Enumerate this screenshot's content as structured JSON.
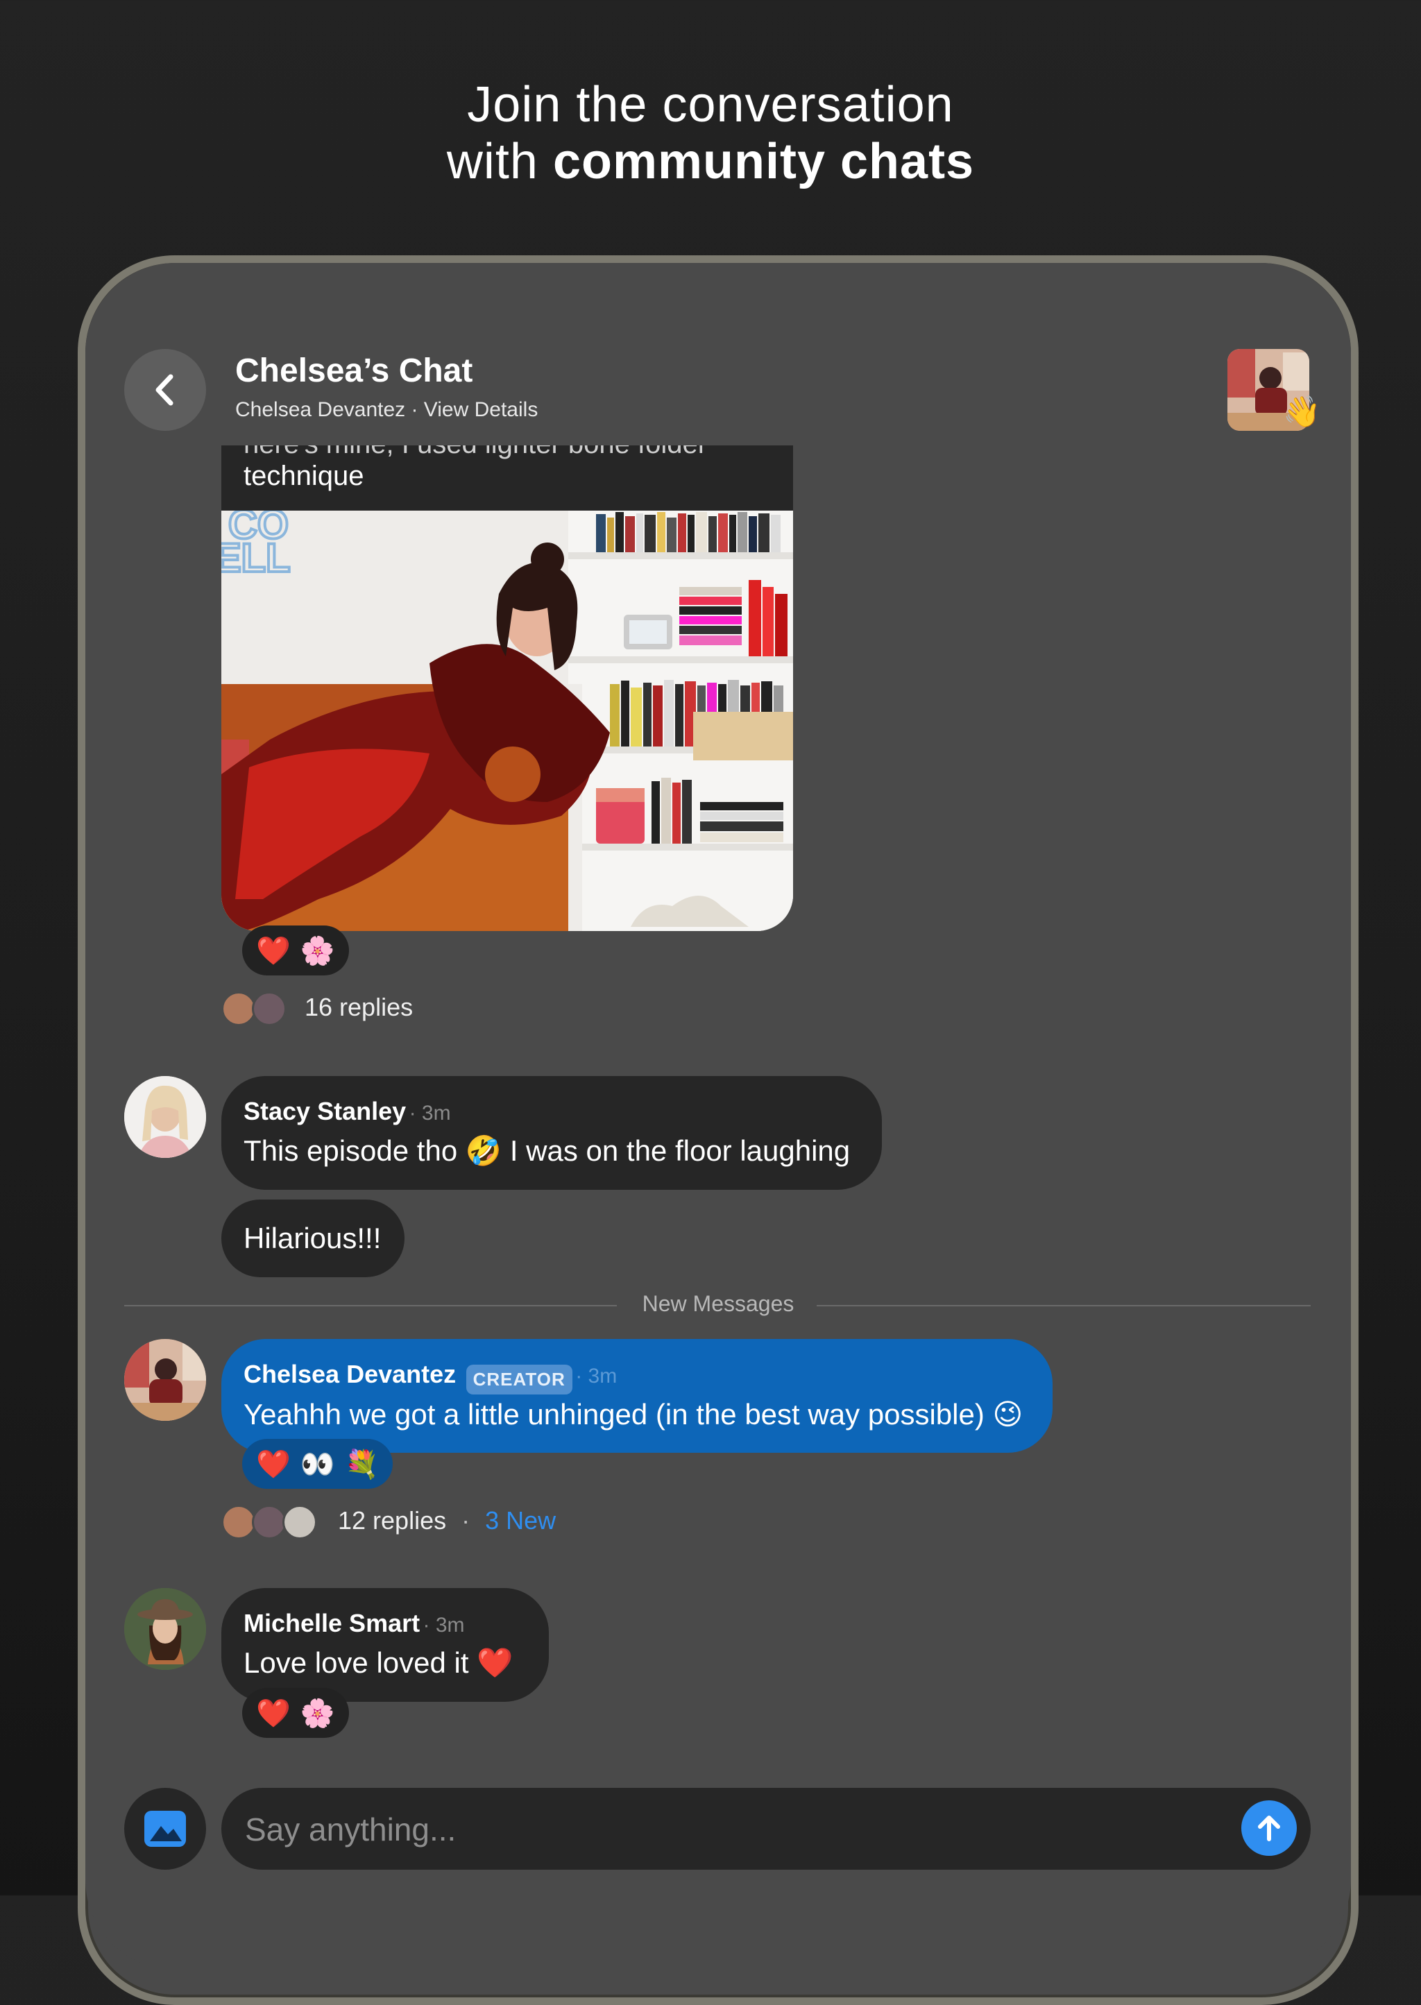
{
  "headline": {
    "line1": "Join the conversation",
    "line2_prefix": "with ",
    "line2_bold": "community chats"
  },
  "header": {
    "title": "Chelsea’s Chat",
    "subtitle": "Chelsea Devantez · View Details",
    "wave": "👋"
  },
  "post": {
    "caption_cut": "here's mine, I used lighter bone folder",
    "caption": "technique",
    "reactions": [
      "❤️",
      "🌸"
    ],
    "replies": "16 replies"
  },
  "messages": [
    {
      "name": "Stacy Stanley",
      "time": "3m",
      "text": "This episode tho 🤣 I was on the floor laughing",
      "followup": "Hilarious!!!"
    },
    {
      "name": "Chelsea Devantez",
      "badge": "CREATOR",
      "time": "3m",
      "text": "Yeahhh we got a little unhinged (in the best way possible) 😉",
      "reactions": [
        "❤️",
        "👀",
        "💐"
      ],
      "replies": "12 replies",
      "new_count": "3 New"
    },
    {
      "name": "Michelle Smart",
      "time": "3m",
      "text": "Love love loved it ❤️",
      "reactions": [
        "❤️",
        "🌸"
      ]
    }
  ],
  "divider": {
    "label": "New Messages"
  },
  "composer": {
    "placeholder": "Say anything..."
  },
  "colors": {
    "accent": "#2f8ef0",
    "creator_bubble": "#0d66b8",
    "background": "#4a4a4a"
  },
  "icons": [
    "chevron-left-icon",
    "image-icon",
    "arrow-up-icon"
  ]
}
